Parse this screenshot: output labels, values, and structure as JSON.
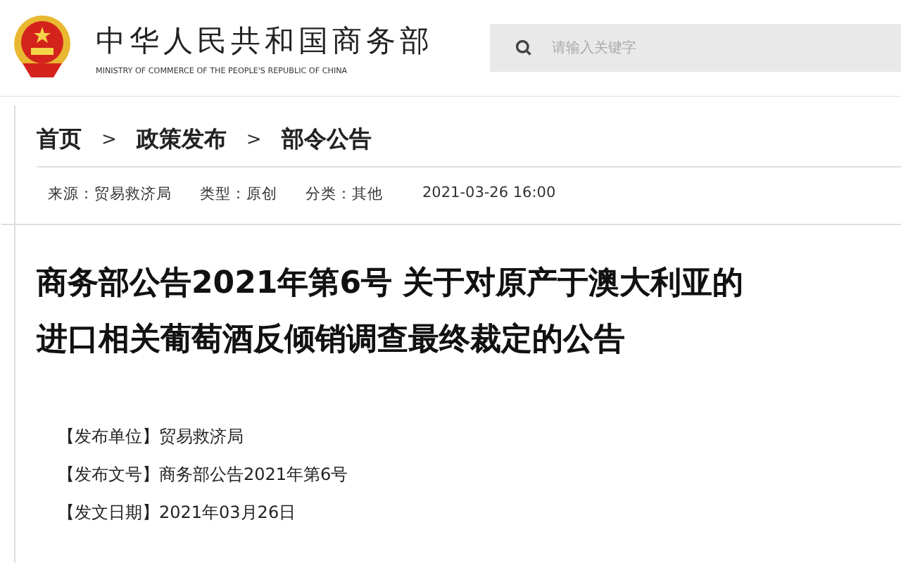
{
  "header": {
    "site_name": "中华人民共和国商务部",
    "site_name_en": "MINISTRY OF COMMERCE OF THE PEOPLE'S REPUBLIC OF CHINA",
    "search": {
      "placeholder": "请输入关键字"
    }
  },
  "breadcrumb": [
    {
      "label": "首页"
    },
    {
      "label": "政策发布"
    },
    {
      "label": "部令公告"
    }
  ],
  "breadcrumb_separator": ">",
  "meta": [
    "来源：贸易救济局",
    "类型：原创",
    "分类：其他",
    "2021-03-26 16:00"
  ],
  "title_lines": [
    "商务部公告2021年第6号 关于对原产于澳大利亚的",
    "进口相关葡萄酒反倾销调查最终裁定的公告"
  ],
  "info": [
    {
      "label": "【发布单位】",
      "value": "贸易救济局"
    },
    {
      "label": "【发布文号】",
      "value": "商务部公告2021年第6号"
    },
    {
      "label": "【发文日期】",
      "value": "2021年03月26日"
    }
  ]
}
